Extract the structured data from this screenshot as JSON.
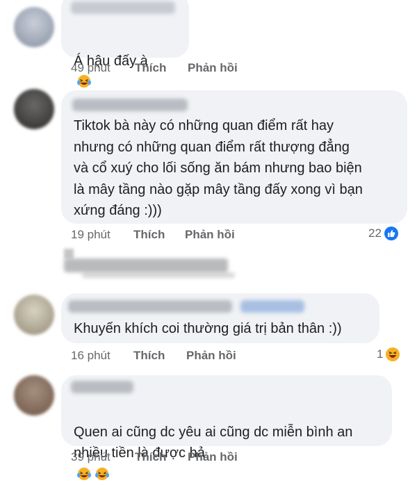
{
  "comments": [
    {
      "text": "Á hậu đấy à",
      "emoji_count": 1,
      "time": "49 phút",
      "like": "Thích",
      "reply": "Phản hồi"
    },
    {
      "text": "Tiktok bà này có những quan điểm rất hay\nnhưng có những quan điểm rất thượng đẳng\nvà cổ xuý cho lối sống ăn bám nhưng bao biện\nlà mây tầng nào gặp mây tầng đấy xong vì bạn\nxứng đáng :)))",
      "time": "19 phút",
      "like": "Thích",
      "reply": "Phản hồi",
      "reaction_count": "22",
      "reaction_icon": "like-icon"
    },
    {
      "text": "Khuyến khích coi thường giá trị bản thân :))",
      "time": "16 phút",
      "like": "Thích",
      "reply": "Phản hồi",
      "reaction_count": "1",
      "reaction_icon": "haha-icon"
    },
    {
      "text": "Quen ai cũng dc yêu ai cũng dc miễn bình an\nnhiều tiền là được hả",
      "emoji_count": 2,
      "time": "39 phút",
      "like": "Thích",
      "reply": "Phản hồi"
    }
  ],
  "colors": {
    "bubble": "#f0f2f5",
    "meta_text": "#65676b",
    "like_blue": "#1877f2",
    "haha_yellow": "#f7b125"
  }
}
